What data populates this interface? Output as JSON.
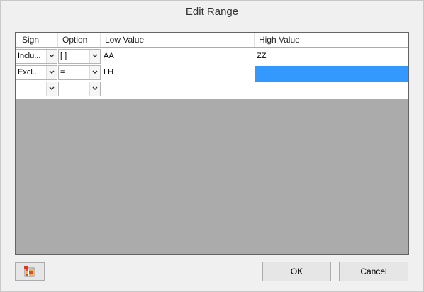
{
  "window": {
    "title": "Edit Range"
  },
  "grid": {
    "columns": [
      "Sign",
      "Option",
      "Low Value",
      "High Value"
    ],
    "rows": [
      {
        "sign": "Inclu...",
        "option": "[ ]",
        "low": "AA",
        "high": "ZZ",
        "high_selected": false
      },
      {
        "sign": "Excl...",
        "option": "=",
        "low": "LH",
        "high": "",
        "high_selected": true
      },
      {
        "sign": "",
        "option": "",
        "low": "",
        "high": "",
        "high_selected": false
      }
    ]
  },
  "buttons": {
    "ok": "OK",
    "cancel": "Cancel"
  },
  "icons": {
    "toolbar": "multi-select-list-icon",
    "dropdown": "chevron-down-icon"
  },
  "colors": {
    "selection": "#3399ff",
    "empty_area": "#ababab"
  }
}
